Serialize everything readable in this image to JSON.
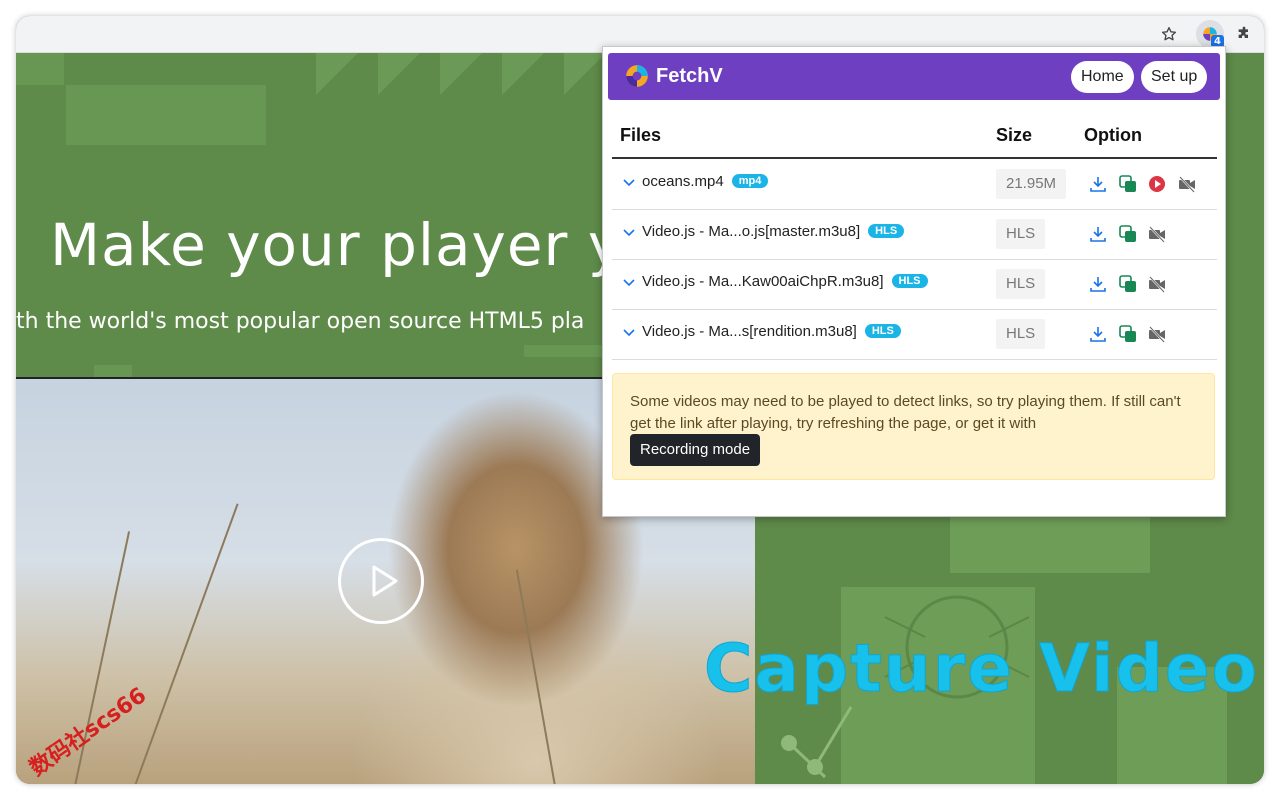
{
  "browser": {
    "extension_badge_count": "4"
  },
  "page": {
    "hero_title": "Make your player yo",
    "hero_subtitle": "th the world's most popular open source HTML5 pla",
    "overlay_caption": "Capture Video",
    "watermark": "数码社scs66"
  },
  "popup": {
    "app_name": "FetchV",
    "home_label": "Home",
    "setup_label": "Set up",
    "columns": {
      "files": "Files",
      "size": "Size",
      "option": "Option"
    },
    "rows": [
      {
        "name": "oceans.mp4",
        "tag": "mp4",
        "size": "21.95M"
      },
      {
        "name": "Video.js - Ma...o.js[master.m3u8]",
        "tag": "HLS",
        "size": "HLS"
      },
      {
        "name": "Video.js - Ma...Kaw00aiChpR.m3u8]",
        "tag": "HLS",
        "size": "HLS"
      },
      {
        "name": "Video.js - Ma...s[rendition.m3u8]",
        "tag": "HLS",
        "size": "HLS"
      }
    ],
    "notice_text": "Some videos may need to be played to detect links, so try playing them. If still can't get the link after playing, try refreshing the page, or get it with",
    "recording_mode_label": "Recording mode"
  },
  "colors": {
    "header_purple": "#6f3fc1",
    "tag_blue": "#1ab4e6",
    "hero_green": "#5e8a4a",
    "caption_cyan": "#18c0ec"
  }
}
